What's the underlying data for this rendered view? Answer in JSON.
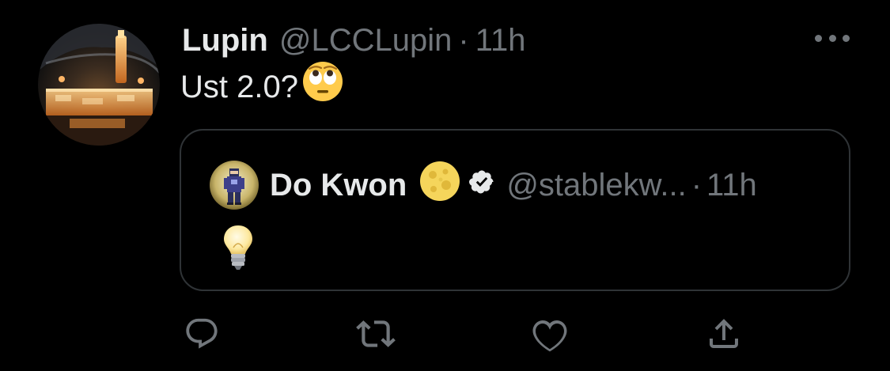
{
  "tweet": {
    "author": {
      "name": "Lupin",
      "handle": "@LCCLupin",
      "avatar_icon": "salt-lamp-cave-avatar"
    },
    "separator": "·",
    "time": "11h",
    "text": "Ust 2.0?",
    "text_emoji": "face-with-rolling-eyes-emoji",
    "more_icon": "more-dots-icon"
  },
  "quote": {
    "author": {
      "name": "Do Kwon",
      "handle": "@stablekw...",
      "avatar_icon": "pixel-character-avatar",
      "name_emoji": "full-moon-emoji",
      "verified_icon": "verified-badge-icon"
    },
    "separator": "·",
    "time": "11h",
    "body_emoji": "light-bulb-emoji"
  },
  "actions": [
    {
      "name": "reply",
      "icon": "reply-icon"
    },
    {
      "name": "retweet",
      "icon": "retweet-icon"
    },
    {
      "name": "like",
      "icon": "heart-icon"
    },
    {
      "name": "share",
      "icon": "share-icon"
    }
  ],
  "colors": {
    "background": "#000000",
    "primary_text": "#e7e9ea",
    "secondary_text": "#71767b",
    "border": "#2f3336"
  }
}
